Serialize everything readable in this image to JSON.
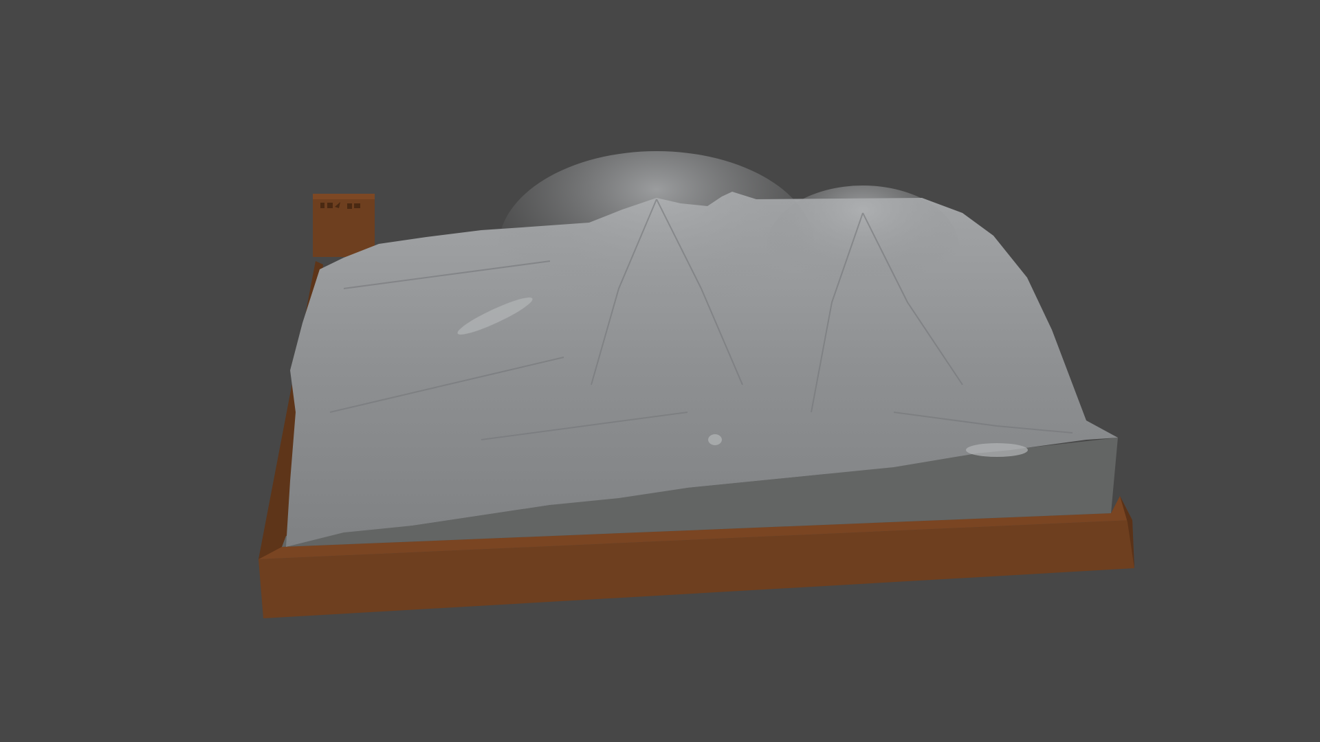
{
  "scene": {
    "subject": "terrain-relief-model",
    "colors": {
      "background": "#474747",
      "base": "#6e3f1f",
      "base_dark": "#5a3218",
      "terrain": "#8c8e90",
      "terrain_light": "#a6a8aa",
      "terrain_side": "#626463"
    }
  }
}
